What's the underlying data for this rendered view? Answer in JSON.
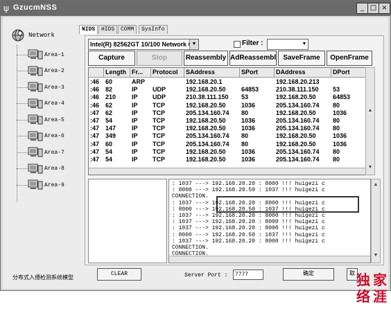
{
  "window": {
    "title": "GzucmNSS",
    "app_icon": "antenna-icon"
  },
  "tree": {
    "root": "Network",
    "items": [
      "Area-1",
      "Area-2",
      "Area-3",
      "Area-4",
      "Area-5",
      "Area-6",
      "Area-7",
      "Area-8",
      "Area-9"
    ]
  },
  "tabs": [
    "NIDS",
    "HIDS",
    "COMM",
    "SysInfo"
  ],
  "adapter": {
    "value": "Intel(R) 82562GT 10/100 Network C"
  },
  "filter": {
    "label": "Filter :",
    "value": ""
  },
  "buttons": {
    "capture": "Capture",
    "stop": "Stop",
    "reassembly": "Reassembly",
    "adreassembly": "AdReassembly",
    "saveframe": "SaveFrame",
    "openframe": "OpenFrame"
  },
  "table": {
    "columns": [
      "",
      "Length",
      "Fr...",
      "Protocol",
      "SAddress",
      "SPort",
      "DAddress",
      "DPort"
    ],
    "rows": [
      [
        ":46",
        "60",
        "ARP",
        "",
        "192.168.20.1",
        "",
        "192.168.20.213",
        ""
      ],
      [
        ":46",
        "82",
        "IP",
        "UDP",
        "192.168.20.50",
        "64853",
        "210.38.111.150",
        "53"
      ],
      [
        ":46",
        "210",
        "IP",
        "UDP",
        "210.38.111.150",
        "53",
        "192.168.20.50",
        "64853"
      ],
      [
        ":46",
        "62",
        "IP",
        "TCP",
        "192.168.20.50",
        "1036",
        "205.134.160.74",
        "80"
      ],
      [
        ":47",
        "62",
        "IP",
        "TCP",
        "205.134.160.74",
        "80",
        "192.168.20.50",
        "1036"
      ],
      [
        ":47",
        "54",
        "IP",
        "TCP",
        "192.168.20.50",
        "1036",
        "205.134.160.74",
        "80"
      ],
      [
        ":47",
        "147",
        "IP",
        "TCP",
        "192.168.20.50",
        "1036",
        "205.134.160.74",
        "80"
      ],
      [
        ":47",
        "349",
        "IP",
        "TCP",
        "205.134.160.74",
        "80",
        "192.168.20.50",
        "1036"
      ],
      [
        ":47",
        "60",
        "IP",
        "TCP",
        "205.134.160.74",
        "80",
        "192.168.20.50",
        "1036"
      ],
      [
        ":47",
        "54",
        "IP",
        "TCP",
        "192.168.20.50",
        "1036",
        "205.134.160.74",
        "80"
      ],
      [
        ":47",
        "54",
        "IP",
        "TCP",
        "192.168.20.50",
        "1036",
        "205.134.160.74",
        "80"
      ]
    ]
  },
  "log": [
    ": 1037 ---> 192.168.20.20 : 8000  !!! huigezi c",
    ": 8000 ---> 192.168.20.50 : 1037  !!! huigezi c",
    "CONNECTION.",
    ": 1037 ---> 192.168.20.20 : 8000  !!! huigezi c",
    ": 8000 ---> 192.168.20.50 : 1037  !!! huigezi c",
    ": 1037 ---> 192.168.20.20 : 8000  !!! huigezi c",
    ": 1037 ---> 192.168.20.20 : 8000  !!! huigezi c",
    ": 1037 ---> 192.168.20.20 : 8000  !!! huigezi c",
    ": 8000 ---> 192.168.20.50 : 1037  !!! huigezi c",
    ": 1037 ---> 192.168.20.20 : 8000  !!! huigezi c",
    "CONNECTION.",
    "CONNECTION."
  ],
  "status": {
    "text": "分布式入侵检测系统模型"
  },
  "footer": {
    "clear": "CLEAR",
    "server_port_label": "Server Port :",
    "server_port_value": "7777",
    "ok": "确定",
    "cancel": "取"
  },
  "stamp": {
    "text": "独家涯",
    "color": "#c8102e"
  }
}
